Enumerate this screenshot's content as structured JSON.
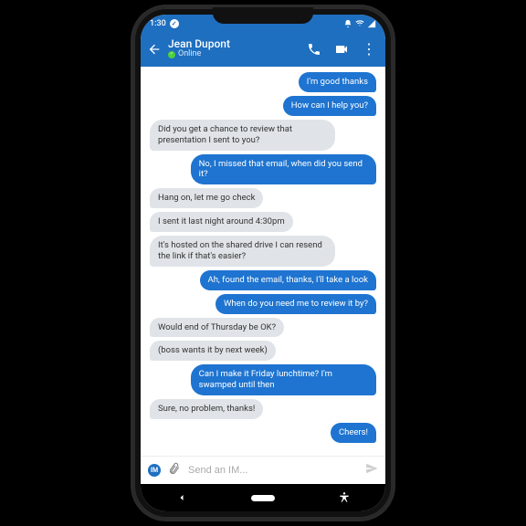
{
  "status": {
    "time": "1:30"
  },
  "header": {
    "name": "Jean Dupont",
    "status": "Online"
  },
  "messages": [
    {
      "side": "out",
      "text": "I'm good thanks"
    },
    {
      "side": "out",
      "text": "How can I help you?"
    },
    {
      "side": "in",
      "text": "Did you get a chance to review that presentation I sent to you?"
    },
    {
      "side": "out",
      "text": "No, I missed that email, when did you send it?"
    },
    {
      "side": "in",
      "text": "Hang on, let me go check"
    },
    {
      "side": "in",
      "text": "I sent it last night around 4:30pm"
    },
    {
      "side": "in",
      "text": "It's hosted on the shared drive I can resend the link if that's easier?"
    },
    {
      "side": "out",
      "text": "Ah, found the email, thanks, I'll take a look"
    },
    {
      "side": "out",
      "text": "When do you need me to review it by?"
    },
    {
      "side": "in",
      "text": "Would end of Thursday be OK?"
    },
    {
      "side": "in",
      "text": "(boss wants it by next week)"
    },
    {
      "side": "out",
      "text": "Can I make it Friday lunchtime?  I'm swamped until then"
    },
    {
      "side": "in",
      "text": "Sure, no problem, thanks!"
    },
    {
      "side": "out",
      "text": "Cheers!"
    }
  ],
  "input": {
    "im_label": "IM",
    "placeholder": "Send an IM..."
  }
}
